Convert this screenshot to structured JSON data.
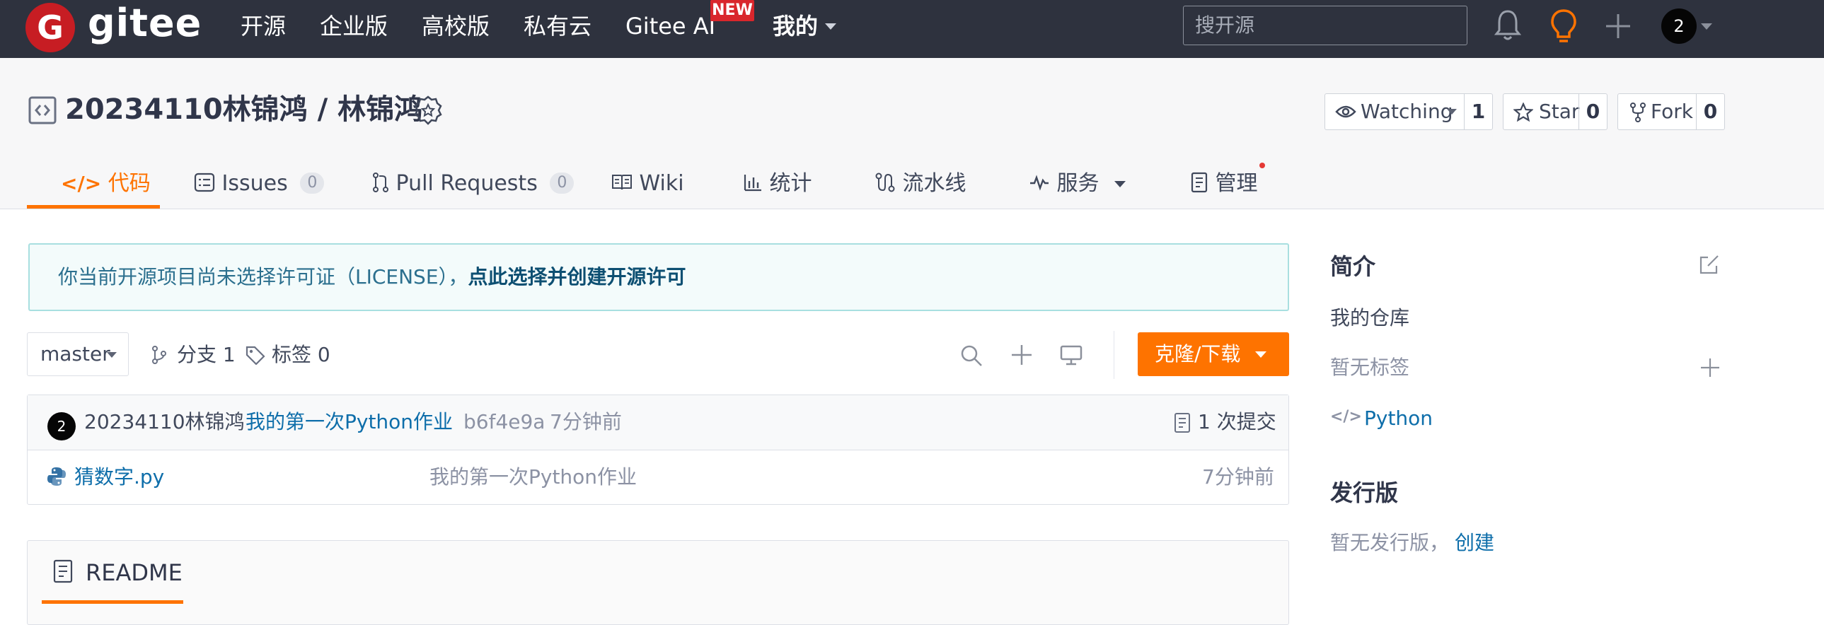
{
  "nav": {
    "logo_letter": "G",
    "logo_text": "gitee",
    "items": [
      "开源",
      "企业版",
      "高校版",
      "私有云",
      "Gitee AI",
      "我的"
    ],
    "new_badge": "NEW",
    "search_placeholder": "搜开源",
    "avatar_text": "2"
  },
  "repo": {
    "title": "20234110林锦鸿 / 林锦鸿",
    "watching": {
      "label": "Watching",
      "count": "1"
    },
    "star": {
      "label": "Star",
      "count": "0"
    },
    "fork": {
      "label": "Fork",
      "count": "0"
    }
  },
  "tabs": [
    {
      "label": "代码"
    },
    {
      "label": "Issues",
      "count": "0"
    },
    {
      "label": "Pull Requests",
      "count": "0"
    },
    {
      "label": "Wiki"
    },
    {
      "label": "统计"
    },
    {
      "label": "流水线"
    },
    {
      "label": "服务"
    },
    {
      "label": "管理"
    }
  ],
  "license": {
    "text": "你当前开源项目尚未选择许可证（LICENSE），",
    "link": "点此选择并创建开源许可"
  },
  "toolbar": {
    "branch": "master",
    "branches": "分支 1",
    "tags": "标签 0",
    "clone": "克隆/下载"
  },
  "commit": {
    "avatar": "2",
    "author": "20234110林锦鸿",
    "message": "我的第一次Python作业",
    "hash": "b6f4e9a",
    "time": "7分钟前",
    "count": "1 次提交"
  },
  "files": [
    {
      "name": "猜数字.py",
      "message": "我的第一次Python作业",
      "time": "7分钟前"
    }
  ],
  "readme": {
    "title": "README"
  },
  "sidebar": {
    "intro_title": "简介",
    "description": "我的仓库",
    "no_tags": "暂无标签",
    "language": "Python",
    "release_title": "发行版",
    "no_release": "暂无发行版，",
    "create_link": "创建"
  },
  "colors": {
    "nav_bg": "#2e323e",
    "brand_red": "#c71d23",
    "accent_orange": "#fe7300",
    "link_blue": "#0e6eaa"
  }
}
